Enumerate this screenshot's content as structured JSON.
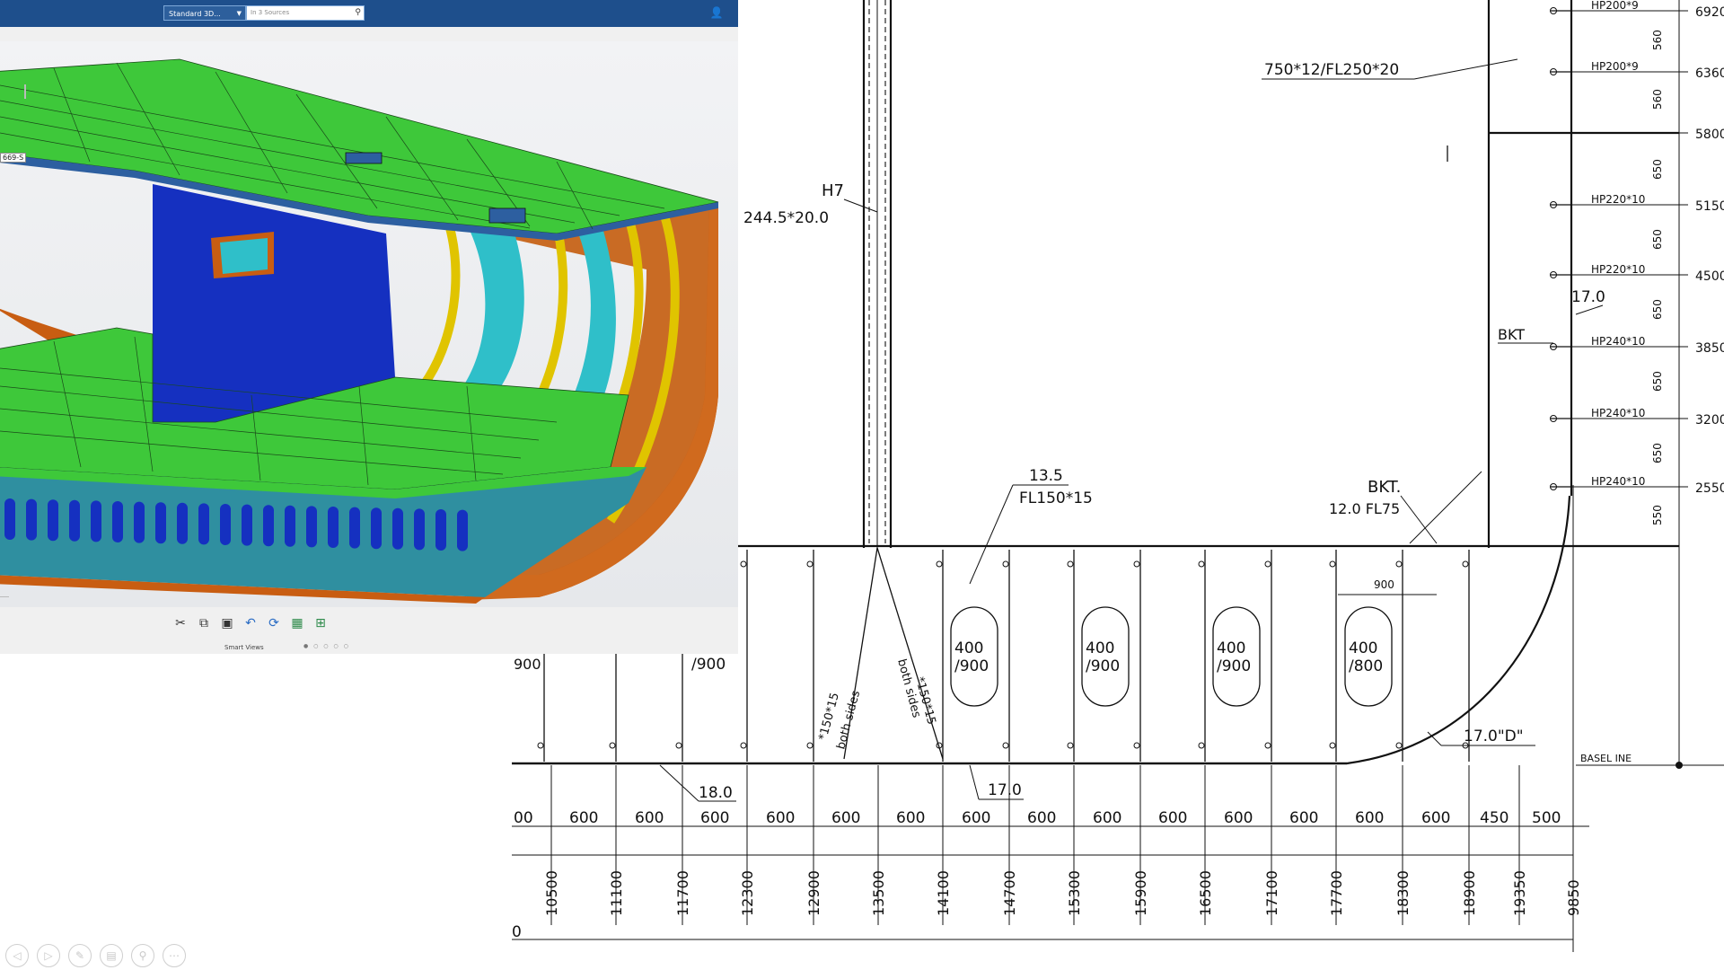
{
  "cad_window": {
    "view_combo": "Standard 3D...",
    "search_placeholder": "In 3 Sources",
    "part_label": "669-S",
    "smart_views_label": "Smart Views",
    "toolbar_icons": [
      "cut-icon",
      "copy-icon",
      "paste-icon",
      "undo-icon",
      "update-icon",
      "view-icon",
      "reframe-icon"
    ]
  },
  "drawing": {
    "frame_elev": [
      "6920",
      "6360",
      "5800",
      "5150",
      "4500",
      "3850",
      "3200",
      "2550"
    ],
    "frame_labels": [
      "HP200*9",
      "HP200*9",
      "HP220*10",
      "HP220*10",
      "HP240*10",
      "HP240*10",
      "HP240*10"
    ],
    "vertical_spacings": [
      "560",
      "560",
      "650",
      "650",
      "650",
      "650",
      "650",
      "550"
    ],
    "plate_spec": "750*12/FL250*20",
    "h7_label": "H7",
    "h7_size": "244.5*20.0",
    "bkt_label": "BKT",
    "bkt_thickness": "17.0",
    "thk_13_5": "13.5",
    "fl150": "FL150*15",
    "bkt2_label": "BKT.",
    "bkt2_spec": "12.0 FL75",
    "spacing_900": "900",
    "openings": [
      "400\n/900",
      "400\n/900",
      "400\n/900",
      "400\n/800"
    ],
    "opening_left_partial": "900",
    "opening_left_partial2": "/900",
    "stiff_label_left": "*150*15",
    "stiff_label_left2": "both sides",
    "stiff_label_right": "*150*15",
    "stiff_label_right2": "both sides",
    "thk_18": "18.0",
    "thk_17_bottom": "17.0",
    "thk_17d": "17.0\"D\"",
    "baseline": "BASEL INE",
    "bottom_spacings": [
      "600",
      "600",
      "600",
      "600",
      "600",
      "600",
      "600",
      "600",
      "600",
      "600",
      "600",
      "600",
      "600",
      "600",
      "450",
      "500"
    ],
    "bottom_spacing_partial": "00",
    "frame_positions": [
      "10500",
      "11100",
      "11700",
      "12300",
      "12900",
      "13500",
      "14100",
      "14700",
      "15300",
      "15900",
      "16500",
      "17100",
      "17700",
      "18300",
      "18900",
      "19350",
      "9850"
    ]
  },
  "slide_nav": {
    "icons": [
      "prev-icon",
      "next-icon",
      "pen-icon",
      "slides-icon",
      "zoom-icon",
      "more-icon"
    ]
  }
}
